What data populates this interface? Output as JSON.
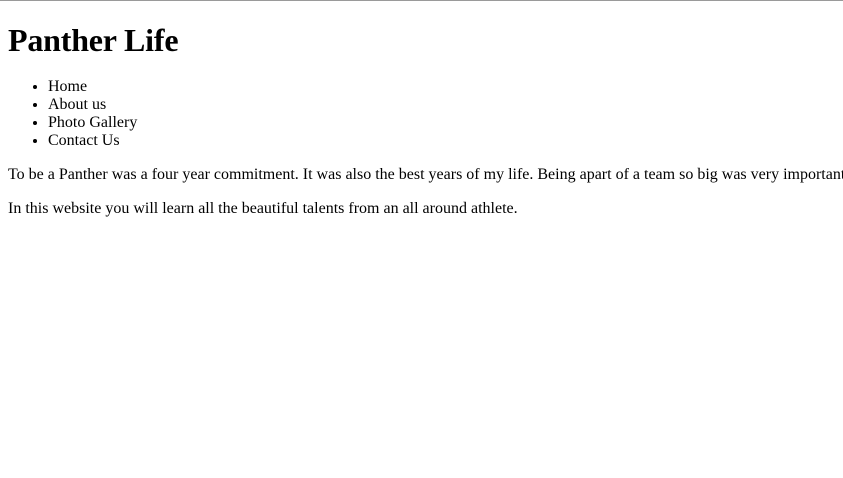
{
  "page": {
    "title": "Panther Life"
  },
  "nav": {
    "items": [
      {
        "label": "Home"
      },
      {
        "label": "About us"
      },
      {
        "label": "Photo Gallery"
      },
      {
        "label": "Contact Us"
      }
    ]
  },
  "content": {
    "paragraphs": [
      "To be a Panther was a four year commitment. It was also the best years of my life. Being apart of a team so big was very important",
      "In this website you will learn all the beautiful talents from an all around athlete."
    ]
  }
}
